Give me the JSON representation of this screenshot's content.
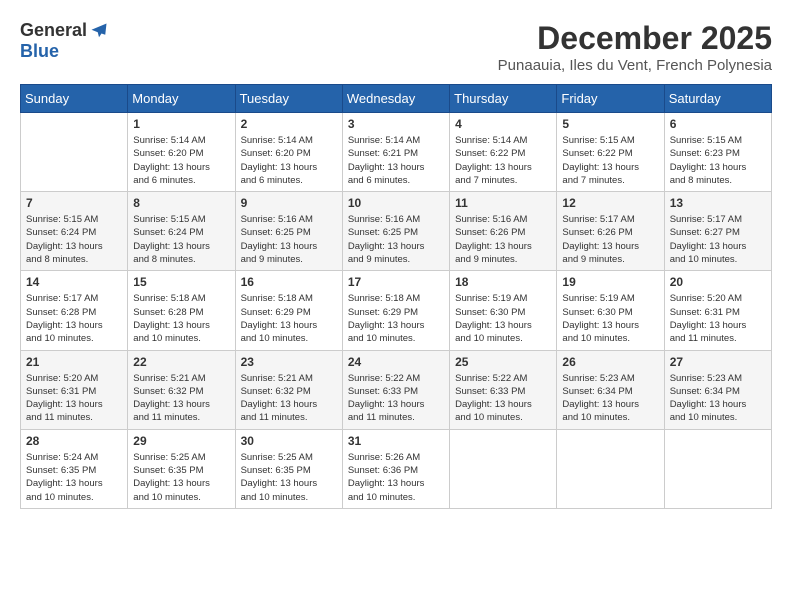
{
  "logo": {
    "general": "General",
    "blue": "Blue"
  },
  "title": "December 2025",
  "subtitle": "Punaauia, Iles du Vent, French Polynesia",
  "weekdays": [
    "Sunday",
    "Monday",
    "Tuesday",
    "Wednesday",
    "Thursday",
    "Friday",
    "Saturday"
  ],
  "weeks": [
    [
      {
        "day": "",
        "info": ""
      },
      {
        "day": "1",
        "info": "Sunrise: 5:14 AM\nSunset: 6:20 PM\nDaylight: 13 hours\nand 6 minutes."
      },
      {
        "day": "2",
        "info": "Sunrise: 5:14 AM\nSunset: 6:20 PM\nDaylight: 13 hours\nand 6 minutes."
      },
      {
        "day": "3",
        "info": "Sunrise: 5:14 AM\nSunset: 6:21 PM\nDaylight: 13 hours\nand 6 minutes."
      },
      {
        "day": "4",
        "info": "Sunrise: 5:14 AM\nSunset: 6:22 PM\nDaylight: 13 hours\nand 7 minutes."
      },
      {
        "day": "5",
        "info": "Sunrise: 5:15 AM\nSunset: 6:22 PM\nDaylight: 13 hours\nand 7 minutes."
      },
      {
        "day": "6",
        "info": "Sunrise: 5:15 AM\nSunset: 6:23 PM\nDaylight: 13 hours\nand 8 minutes."
      }
    ],
    [
      {
        "day": "7",
        "info": "Sunrise: 5:15 AM\nSunset: 6:24 PM\nDaylight: 13 hours\nand 8 minutes."
      },
      {
        "day": "8",
        "info": "Sunrise: 5:15 AM\nSunset: 6:24 PM\nDaylight: 13 hours\nand 8 minutes."
      },
      {
        "day": "9",
        "info": "Sunrise: 5:16 AM\nSunset: 6:25 PM\nDaylight: 13 hours\nand 9 minutes."
      },
      {
        "day": "10",
        "info": "Sunrise: 5:16 AM\nSunset: 6:25 PM\nDaylight: 13 hours\nand 9 minutes."
      },
      {
        "day": "11",
        "info": "Sunrise: 5:16 AM\nSunset: 6:26 PM\nDaylight: 13 hours\nand 9 minutes."
      },
      {
        "day": "12",
        "info": "Sunrise: 5:17 AM\nSunset: 6:26 PM\nDaylight: 13 hours\nand 9 minutes."
      },
      {
        "day": "13",
        "info": "Sunrise: 5:17 AM\nSunset: 6:27 PM\nDaylight: 13 hours\nand 10 minutes."
      }
    ],
    [
      {
        "day": "14",
        "info": "Sunrise: 5:17 AM\nSunset: 6:28 PM\nDaylight: 13 hours\nand 10 minutes."
      },
      {
        "day": "15",
        "info": "Sunrise: 5:18 AM\nSunset: 6:28 PM\nDaylight: 13 hours\nand 10 minutes."
      },
      {
        "day": "16",
        "info": "Sunrise: 5:18 AM\nSunset: 6:29 PM\nDaylight: 13 hours\nand 10 minutes."
      },
      {
        "day": "17",
        "info": "Sunrise: 5:18 AM\nSunset: 6:29 PM\nDaylight: 13 hours\nand 10 minutes."
      },
      {
        "day": "18",
        "info": "Sunrise: 5:19 AM\nSunset: 6:30 PM\nDaylight: 13 hours\nand 10 minutes."
      },
      {
        "day": "19",
        "info": "Sunrise: 5:19 AM\nSunset: 6:30 PM\nDaylight: 13 hours\nand 10 minutes."
      },
      {
        "day": "20",
        "info": "Sunrise: 5:20 AM\nSunset: 6:31 PM\nDaylight: 13 hours\nand 11 minutes."
      }
    ],
    [
      {
        "day": "21",
        "info": "Sunrise: 5:20 AM\nSunset: 6:31 PM\nDaylight: 13 hours\nand 11 minutes."
      },
      {
        "day": "22",
        "info": "Sunrise: 5:21 AM\nSunset: 6:32 PM\nDaylight: 13 hours\nand 11 minutes."
      },
      {
        "day": "23",
        "info": "Sunrise: 5:21 AM\nSunset: 6:32 PM\nDaylight: 13 hours\nand 11 minutes."
      },
      {
        "day": "24",
        "info": "Sunrise: 5:22 AM\nSunset: 6:33 PM\nDaylight: 13 hours\nand 11 minutes."
      },
      {
        "day": "25",
        "info": "Sunrise: 5:22 AM\nSunset: 6:33 PM\nDaylight: 13 hours\nand 10 minutes."
      },
      {
        "day": "26",
        "info": "Sunrise: 5:23 AM\nSunset: 6:34 PM\nDaylight: 13 hours\nand 10 minutes."
      },
      {
        "day": "27",
        "info": "Sunrise: 5:23 AM\nSunset: 6:34 PM\nDaylight: 13 hours\nand 10 minutes."
      }
    ],
    [
      {
        "day": "28",
        "info": "Sunrise: 5:24 AM\nSunset: 6:35 PM\nDaylight: 13 hours\nand 10 minutes."
      },
      {
        "day": "29",
        "info": "Sunrise: 5:25 AM\nSunset: 6:35 PM\nDaylight: 13 hours\nand 10 minutes."
      },
      {
        "day": "30",
        "info": "Sunrise: 5:25 AM\nSunset: 6:35 PM\nDaylight: 13 hours\nand 10 minutes."
      },
      {
        "day": "31",
        "info": "Sunrise: 5:26 AM\nSunset: 6:36 PM\nDaylight: 13 hours\nand 10 minutes."
      },
      {
        "day": "",
        "info": ""
      },
      {
        "day": "",
        "info": ""
      },
      {
        "day": "",
        "info": ""
      }
    ]
  ]
}
